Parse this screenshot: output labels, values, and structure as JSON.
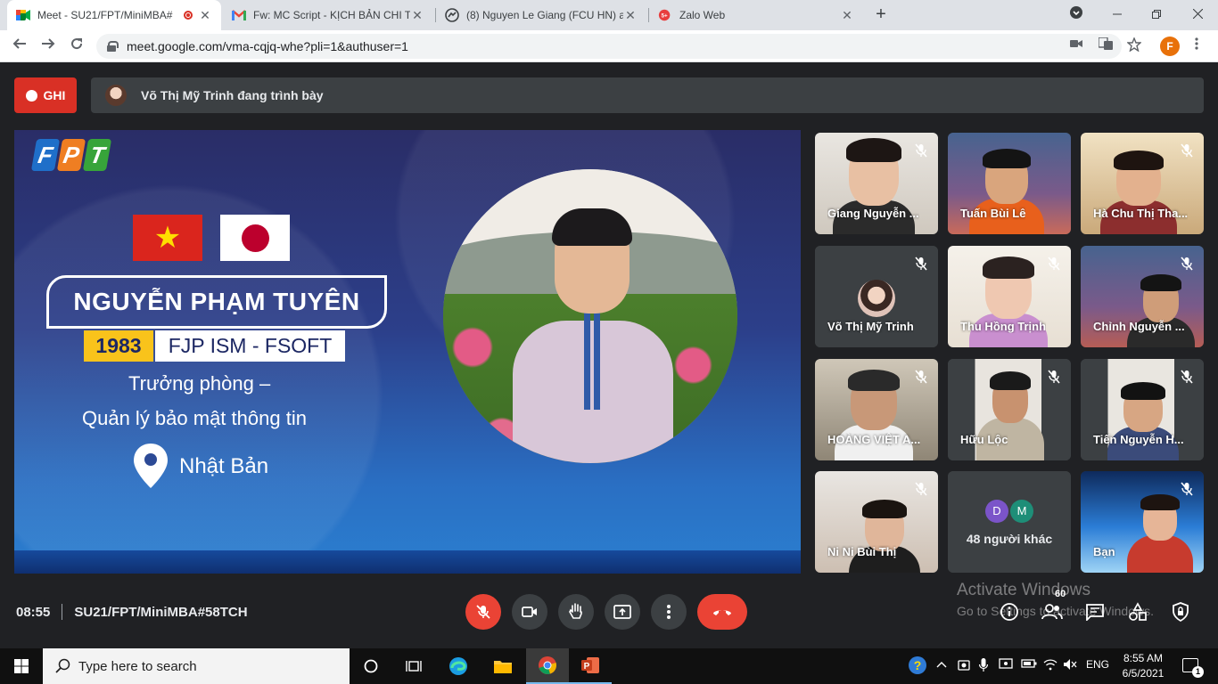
{
  "browser": {
    "tabs": [
      {
        "title": "Meet - SU21/FPT/MiniMBA#",
        "icon": "google-meet-icon",
        "recording": true,
        "close": "✕"
      },
      {
        "title": "Fw: MC Script - KỊCH BẢN CHI TI",
        "icon": "gmail-icon",
        "close": "✕"
      },
      {
        "title": "(8) Nguyen Le Giang (FCU HN) ar",
        "icon": "messenger-icon",
        "close": "✕"
      },
      {
        "title": "Zalo Web",
        "icon": "zalo-icon",
        "badge": "5+",
        "close": "✕"
      }
    ],
    "new_tab": "+",
    "url": "meet.google.com/vma-cqjq-whe?pli=1&authuser=1",
    "profile_initial": "F"
  },
  "meet": {
    "record_label": "GHI",
    "presenter_text": "Võ Thị Mỹ Trinh đang trình bày",
    "slide": {
      "logo": [
        "F",
        "P",
        "T"
      ],
      "name": "NGUYỄN PHẠM TUYÊN",
      "year": "1983",
      "department": "FJP ISM - FSOFT",
      "role_line1": "Trưởng phòng –",
      "role_line2": "Quản lý bảo mật thông tin",
      "location": "Nhật Bản"
    },
    "participants": [
      {
        "name": "Giang Nguyễn ...",
        "muted": true
      },
      {
        "name": "Tuấn Bùi Lê",
        "muted": false
      },
      {
        "name": "Hà Chu Thị Tha...",
        "muted": true
      },
      {
        "name": "Võ Thị Mỹ Trinh",
        "muted": true
      },
      {
        "name": "Thu Hồng Trịnh",
        "muted": true
      },
      {
        "name": "Chỉnh Nguyễn ...",
        "muted": true
      },
      {
        "name": "HOÀNG VIỆT A...",
        "muted": true
      },
      {
        "name": "Hữu Lộc",
        "muted": true
      },
      {
        "name": "Tiến Nguyễn H...",
        "muted": true
      },
      {
        "name": "Ni Ni Bùi Thị",
        "muted": true
      },
      {
        "name": "48 người khác",
        "avatars": [
          "D",
          "M"
        ],
        "avatar_colors": [
          "#7b54c9",
          "#1e8e78"
        ]
      },
      {
        "name": "Bạn",
        "muted": true
      }
    ],
    "time": "08:55",
    "meeting_name": "SU21/FPT/MiniMBA#58TCH",
    "participant_count": "60",
    "colors": {
      "record_red": "#d93025",
      "hangup_red": "#ea4335",
      "meet_bg": "#202124",
      "tile_bg": "#3c4043"
    }
  },
  "watermark": {
    "line1": "Activate Windows",
    "line2": "Go to Settings to activate Windows."
  },
  "taskbar": {
    "search_placeholder": "Type here to search",
    "language": "ENG",
    "time": "8:55 AM",
    "date": "6/5/2021",
    "notification_count": "1"
  }
}
